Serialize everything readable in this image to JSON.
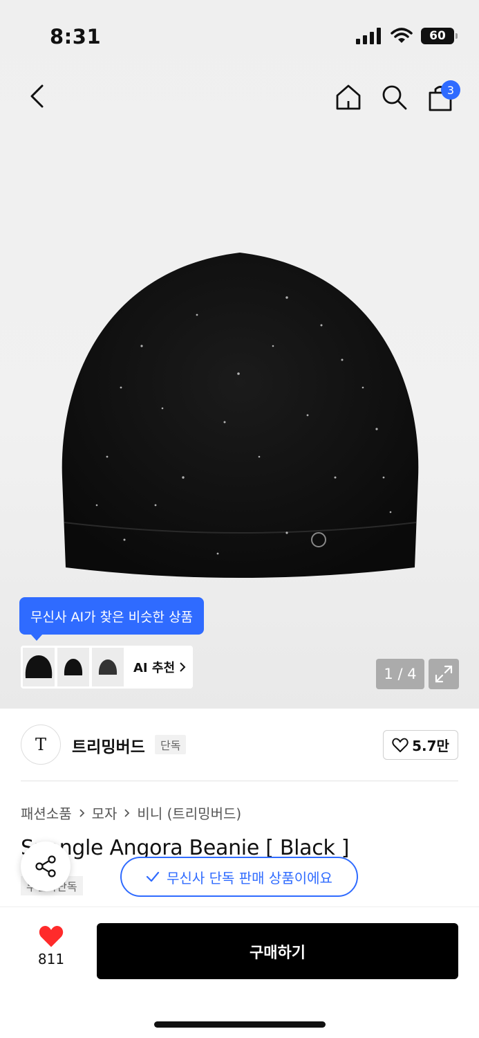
{
  "status_bar": {
    "time": "8:31",
    "battery": "60"
  },
  "nav": {
    "cart_count": "3"
  },
  "image": {
    "counter": "1 / 4"
  },
  "ai": {
    "tooltip": "무신사 AI가 찾은 비슷한 상품",
    "label": "AI 추천"
  },
  "brand": {
    "logo_text": "T",
    "name": "트리밍버드",
    "tag": "단독",
    "likes": "5.7만"
  },
  "breadcrumb": [
    "패션소품",
    "모자",
    "비니 (트리밍버드)"
  ],
  "product": {
    "title": "Spangle Angora Beanie [ Black ]",
    "exclusive_tag": "무신사단독",
    "exclusive_pill": "무신사 단독 판매 상품이에요"
  },
  "bottom": {
    "heart_count": "811",
    "buy_label": "구매하기"
  },
  "colors": {
    "accent": "#2f6bff",
    "heart": "#ff2b2b",
    "buy": "#000000"
  }
}
